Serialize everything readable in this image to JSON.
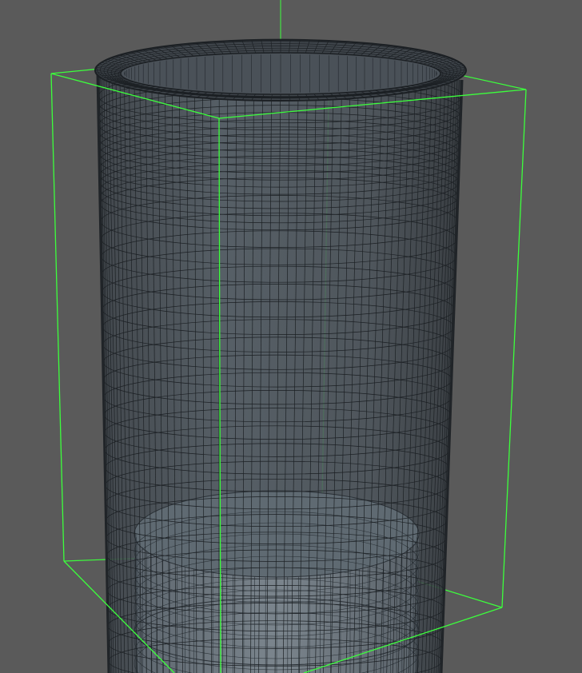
{
  "viewport": {
    "background": "#5a5a5a",
    "selection_color": "#3cff3c",
    "mesh_line_color": "#1e2226",
    "mesh_fill_color": "#4f555b",
    "inner_fill_color": "#6f7880"
  },
  "scene": {
    "selected_object": "cylinder-wireframe",
    "display_mode": "wireframe-on-shaded"
  }
}
